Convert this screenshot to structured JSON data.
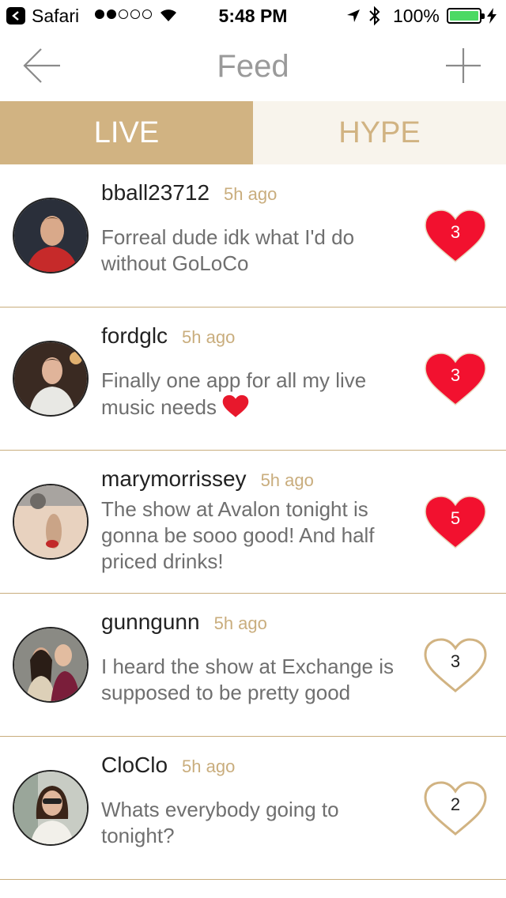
{
  "status_bar": {
    "carrier": "Safari",
    "time": "5:48 PM",
    "battery": "100%"
  },
  "nav": {
    "title": "Feed"
  },
  "tabs": [
    {
      "label": "LIVE",
      "active": true
    },
    {
      "label": "HYPE",
      "active": false
    }
  ],
  "feed": [
    {
      "username": "bball23712",
      "time": "5h ago",
      "message": "Forreal dude idk what I'd do without GoLoCo",
      "likes": "3",
      "liked": true
    },
    {
      "username": "fordglc",
      "time": "5h ago",
      "message": "Finally one app for all my live music needs",
      "likes": "3",
      "liked": true,
      "emoji": "red-heart-emoji"
    },
    {
      "username": "marymorrissey",
      "time": "5h ago",
      "message": "The show at Avalon tonight is gonna be sooo good! And half priced drinks!",
      "likes": "5",
      "liked": true
    },
    {
      "username": "gunngunn",
      "time": "5h ago",
      "message": "I heard the show at Exchange is supposed to be pretty good",
      "likes": "3",
      "liked": false
    },
    {
      "username": "CloClo",
      "time": "5h ago",
      "message": "Whats everybody going to tonight?",
      "likes": "2",
      "liked": false
    }
  ],
  "colors": {
    "accent": "#d1b382",
    "tab_inactive_bg": "#f8f4ec",
    "heart_filled": "#f2112f",
    "divider": "#c9ad7d"
  }
}
